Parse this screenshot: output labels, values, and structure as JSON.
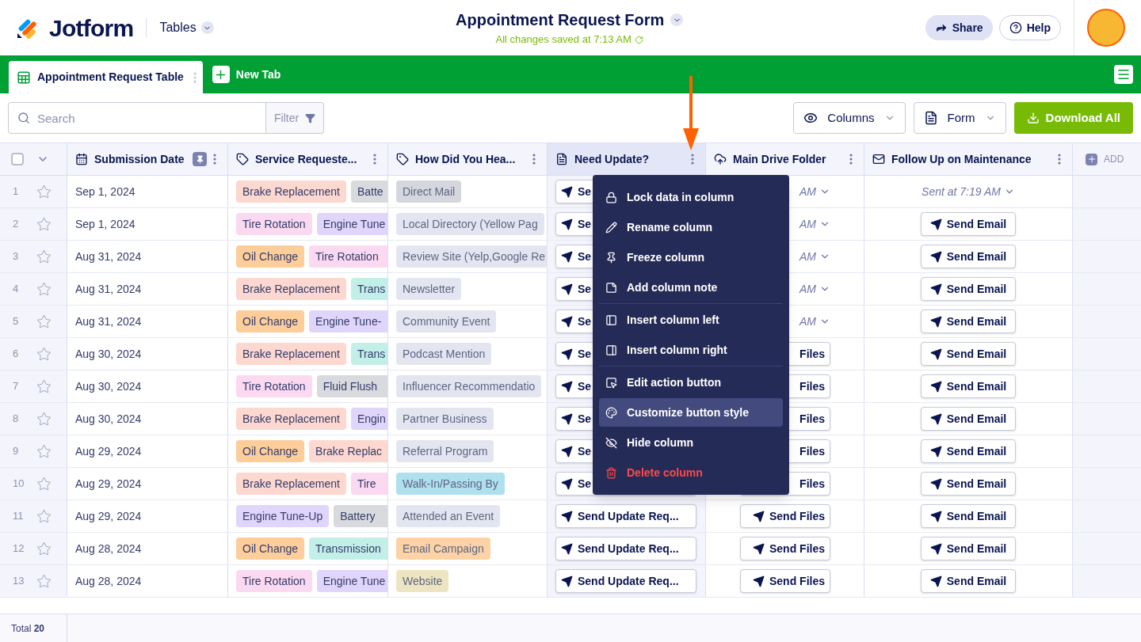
{
  "header": {
    "brand": "Jotform",
    "section": "Tables",
    "title": "Appointment Request Form",
    "saved": "All changes saved at 7:13 AM",
    "share": "Share",
    "help": "Help"
  },
  "tabs": [
    {
      "label": "Appointment Request Table",
      "selected": true
    }
  ],
  "new_tab": "New Tab",
  "toolbar": {
    "search_placeholder": "Search",
    "filter": "Filter",
    "columns": "Columns",
    "form": "Form",
    "download": "Download All"
  },
  "columns": [
    {
      "label": "Submission Date",
      "pinned": true,
      "highlighted": false
    },
    {
      "label": "Service Requeste...",
      "pinned": false,
      "highlighted": false
    },
    {
      "label": "How Did You Hea...",
      "pinned": false,
      "highlighted": false
    },
    {
      "label": "Need Update?",
      "pinned": false,
      "highlighted": true
    },
    {
      "label": "Main Drive Folder",
      "pinned": false,
      "highlighted": false
    },
    {
      "label": "Follow Up on Maintenance",
      "pinned": false,
      "highlighted": false
    }
  ],
  "select_all_checked": false,
  "add_column": "ADD",
  "rows": [
    {
      "num": "1",
      "starred": false,
      "date": "Sep 1, 2024",
      "services": [
        {
          "text": "Brake Replacement",
          "color": "#fdd8d0"
        },
        {
          "text": "Batte",
          "color": "#d8dade"
        }
      ],
      "source": {
        "text": "Direct Mail",
        "color": "#d5d7de"
      },
      "update": {
        "kind": "button",
        "text": "Se"
      },
      "drive": {
        "kind": "sent",
        "text": "AM"
      },
      "follow": {
        "kind": "sent",
        "text": "Sent at 7:19 AM"
      }
    },
    {
      "num": "2",
      "starred": false,
      "date": "Sep 1, 2024",
      "services": [
        {
          "text": "Tire Rotation",
          "color": "#fbd9f1"
        },
        {
          "text": "Engine Tune",
          "color": "#e0d5fb"
        }
      ],
      "source": {
        "text": "Local Directory (Yellow Pag",
        "color": "#e3e6f0"
      },
      "update": {
        "kind": "button",
        "text": "Se"
      },
      "drive": {
        "kind": "sent",
        "text": "AM"
      },
      "follow": {
        "kind": "button",
        "text": "Send Email"
      }
    },
    {
      "num": "3",
      "starred": false,
      "date": "Aug 31, 2024",
      "services": [
        {
          "text": "Oil Change",
          "color": "#fdcd9a"
        },
        {
          "text": "Tire Rotation",
          "color": "#fbd9f1"
        }
      ],
      "source": {
        "text": "Review Site (Yelp,Google Re",
        "color": "#e3e6f0"
      },
      "update": {
        "kind": "button",
        "text": "Se"
      },
      "drive": {
        "kind": "sent",
        "text": "AM"
      },
      "follow": {
        "kind": "button",
        "text": "Send Email"
      }
    },
    {
      "num": "4",
      "starred": false,
      "date": "Aug 31, 2024",
      "services": [
        {
          "text": "Brake Replacement",
          "color": "#fdd8d0"
        },
        {
          "text": "Trans",
          "color": "#c3efe9"
        }
      ],
      "source": {
        "text": "Newsletter",
        "color": "#e3e6f0"
      },
      "update": {
        "kind": "button",
        "text": "Se"
      },
      "drive": {
        "kind": "sent",
        "text": "AM"
      },
      "follow": {
        "kind": "button",
        "text": "Send Email"
      }
    },
    {
      "num": "5",
      "starred": false,
      "date": "Aug 31, 2024",
      "services": [
        {
          "text": "Oil Change",
          "color": "#fdcd9a"
        },
        {
          "text": "Engine Tune-",
          "color": "#e0d5fb"
        }
      ],
      "source": {
        "text": "Community Event",
        "color": "#e3e6f0"
      },
      "update": {
        "kind": "button",
        "text": "Se"
      },
      "drive": {
        "kind": "sent",
        "text": "AM"
      },
      "follow": {
        "kind": "button",
        "text": "Send Email"
      }
    },
    {
      "num": "6",
      "starred": false,
      "date": "Aug 30, 2024",
      "services": [
        {
          "text": "Brake Replacement",
          "color": "#fdd8d0"
        },
        {
          "text": "Trans",
          "color": "#c3efe9"
        }
      ],
      "source": {
        "text": "Podcast Mention",
        "color": "#e3e6f0"
      },
      "update": {
        "kind": "button",
        "text": "Se"
      },
      "drive": {
        "kind": "button",
        "text": "Files",
        "icon": false
      },
      "follow": {
        "kind": "button",
        "text": "Send Email"
      }
    },
    {
      "num": "7",
      "starred": false,
      "date": "Aug 30, 2024",
      "services": [
        {
          "text": "Tire Rotation",
          "color": "#fbd9f1"
        },
        {
          "text": "Fluid Flush",
          "color": "#d8dade"
        }
      ],
      "source": {
        "text": "Influencer Recommendatio",
        "color": "#e3e6f0"
      },
      "update": {
        "kind": "button",
        "text": "Se"
      },
      "drive": {
        "kind": "button",
        "text": "Files",
        "icon": false
      },
      "follow": {
        "kind": "button",
        "text": "Send Email"
      }
    },
    {
      "num": "8",
      "starred": false,
      "date": "Aug 30, 2024",
      "services": [
        {
          "text": "Brake Replacement",
          "color": "#fdd8d0"
        },
        {
          "text": "Engin",
          "color": "#e0d5fb"
        }
      ],
      "source": {
        "text": "Partner Business",
        "color": "#e3e6f0"
      },
      "update": {
        "kind": "button",
        "text": "Se"
      },
      "drive": {
        "kind": "button",
        "text": "Files",
        "icon": false
      },
      "follow": {
        "kind": "button",
        "text": "Send Email"
      }
    },
    {
      "num": "9",
      "starred": false,
      "date": "Aug 29, 2024",
      "services": [
        {
          "text": "Oil Change",
          "color": "#fdcd9a"
        },
        {
          "text": "Brake Replac",
          "color": "#fdd8d0"
        }
      ],
      "source": {
        "text": "Referral Program",
        "color": "#e3e6f0"
      },
      "update": {
        "kind": "button",
        "text": "Se"
      },
      "drive": {
        "kind": "button",
        "text": "Files",
        "icon": false
      },
      "follow": {
        "kind": "button",
        "text": "Send Email"
      }
    },
    {
      "num": "10",
      "starred": false,
      "date": "Aug 29, 2024",
      "services": [
        {
          "text": "Brake Replacement",
          "color": "#fdd8d0"
        },
        {
          "text": "Tire",
          "color": "#fbd9f1"
        }
      ],
      "source": {
        "text": "Walk-In/Passing By",
        "color": "#aee0ee"
      },
      "update": {
        "kind": "button",
        "text": "Se"
      },
      "drive": {
        "kind": "button",
        "text": "Files",
        "icon": false
      },
      "follow": {
        "kind": "button",
        "text": "Send Email"
      }
    },
    {
      "num": "11",
      "starred": false,
      "date": "Aug 29, 2024",
      "services": [
        {
          "text": "Engine Tune-Up",
          "color": "#e0d5fb"
        },
        {
          "text": "Battery",
          "color": "#d8dade"
        }
      ],
      "source": {
        "text": "Attended an Event",
        "color": "#e3e6f0"
      },
      "update": {
        "kind": "button",
        "text": "Send Update Req..."
      },
      "drive": {
        "kind": "button",
        "text": "Send Files"
      },
      "follow": {
        "kind": "button",
        "text": "Send Email"
      }
    },
    {
      "num": "12",
      "starred": false,
      "date": "Aug 28, 2024",
      "services": [
        {
          "text": "Oil Change",
          "color": "#fdcd9a"
        },
        {
          "text": "Transmission",
          "color": "#c3efe9"
        }
      ],
      "source": {
        "text": "Email Campaign",
        "color": "#fdd3a5"
      },
      "update": {
        "kind": "button",
        "text": "Send Update Req..."
      },
      "drive": {
        "kind": "button",
        "text": "Send Files"
      },
      "follow": {
        "kind": "button",
        "text": "Send Email"
      }
    },
    {
      "num": "13",
      "starred": false,
      "date": "Aug 28, 2024",
      "services": [
        {
          "text": "Tire Rotation",
          "color": "#fbd9f1"
        },
        {
          "text": "Engine Tune",
          "color": "#e0d5fb"
        }
      ],
      "source": {
        "text": "Website",
        "color": "#ede5c1"
      },
      "update": {
        "kind": "button",
        "text": "Send Update Req..."
      },
      "drive": {
        "kind": "button",
        "text": "Send Files"
      },
      "follow": {
        "kind": "button",
        "text": "Send Email"
      }
    }
  ],
  "menu": [
    {
      "label": "Lock data in column",
      "kind": "normal",
      "selected": false
    },
    {
      "label": "Rename column",
      "kind": "normal",
      "selected": false
    },
    {
      "label": "Freeze column",
      "kind": "normal",
      "selected": false
    },
    {
      "label": "Add column note",
      "kind": "normal",
      "selected": false,
      "divider_after": true
    },
    {
      "label": "Insert column left",
      "kind": "normal",
      "selected": false
    },
    {
      "label": "Insert column right",
      "kind": "normal",
      "selected": false,
      "divider_after": true
    },
    {
      "label": "Edit action button",
      "kind": "normal",
      "selected": false
    },
    {
      "label": "Customize button style",
      "kind": "normal",
      "selected": true
    },
    {
      "label": "Hide column",
      "kind": "normal",
      "selected": false
    },
    {
      "label": "Delete column",
      "kind": "danger",
      "selected": false
    }
  ],
  "footer": {
    "total": "Total **20**"
  }
}
